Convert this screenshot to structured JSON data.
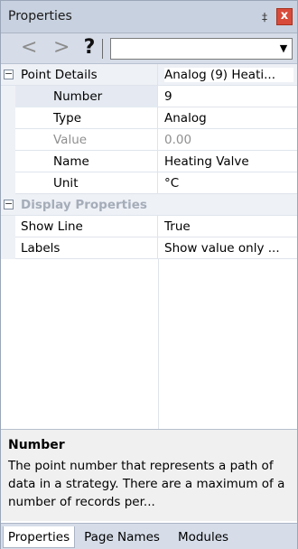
{
  "window": {
    "title": "Properties",
    "pin": "‡",
    "close": "x"
  },
  "toolbar": {
    "back": "<",
    "forward": ">",
    "help": "?",
    "combo_value": "",
    "combo_arrow": "▼"
  },
  "grid": {
    "expand_symbol": "−",
    "categories": [
      {
        "label": "Point Details",
        "value": "Analog (9) Heati...",
        "rows": [
          {
            "label": "Number",
            "value": "9"
          },
          {
            "label": "Type",
            "value": "Analog"
          },
          {
            "label": "Value",
            "value": "0.00"
          },
          {
            "label": "Name",
            "value": "Heating Valve"
          },
          {
            "label": "Unit",
            "value": "°C"
          }
        ]
      },
      {
        "label": "Display Properties",
        "rows": [
          {
            "label": "Show Line",
            "value": "True"
          },
          {
            "label": "Labels",
            "value": "Show value only ..."
          }
        ]
      }
    ]
  },
  "description": {
    "title": "Number",
    "text": "The point number that represents a path of data in a strategy.  There are a maximum of a number of records per..."
  },
  "tabs": [
    {
      "label": "Properties"
    },
    {
      "label": "Page Names"
    },
    {
      "label": "Modules"
    }
  ]
}
